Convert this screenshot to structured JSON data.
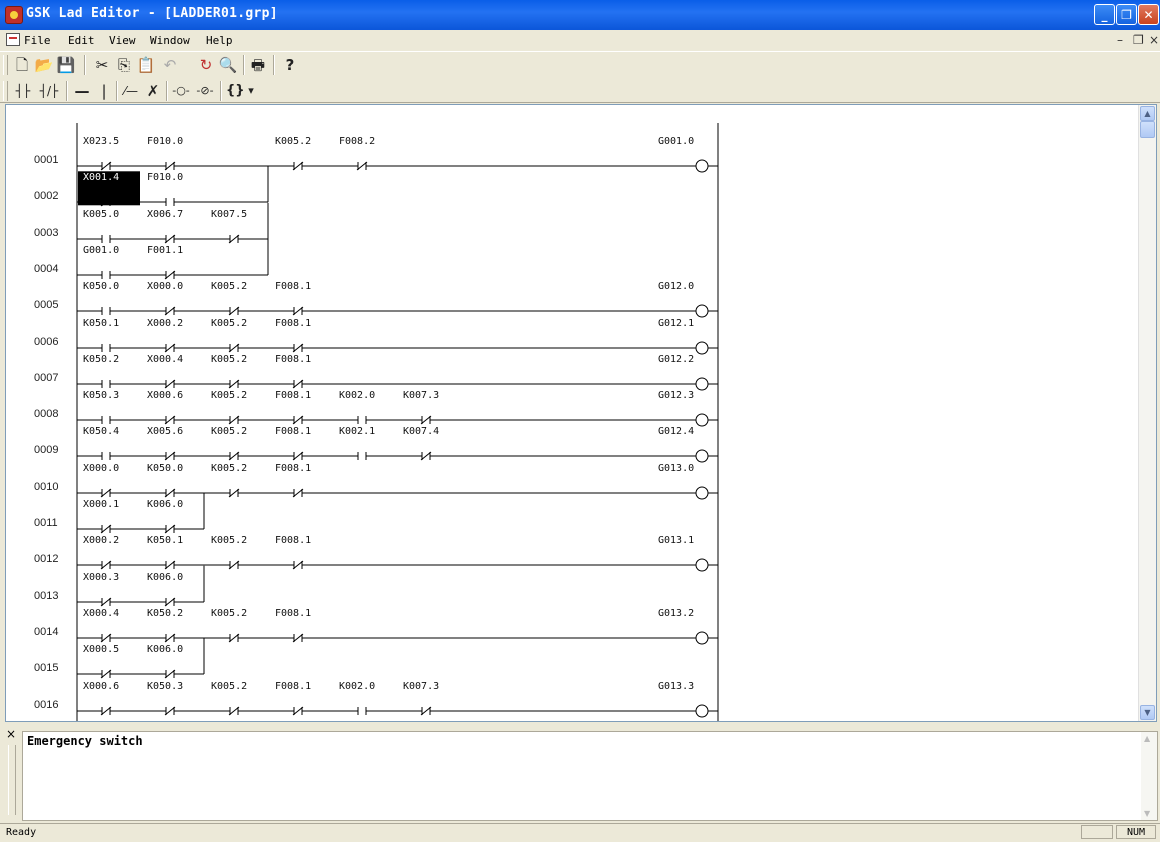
{
  "window": {
    "title": "GSK Lad Editor - [LADDER01.grp]"
  },
  "menu": [
    {
      "label": "File",
      "key": "F"
    },
    {
      "label": "Edit",
      "key": "E"
    },
    {
      "label": "View",
      "key": "V"
    },
    {
      "label": "Window",
      "key": "W"
    },
    {
      "label": "Help",
      "key": "H"
    }
  ],
  "toolbar1": [
    {
      "name": "new-icon",
      "glyph": "🗋"
    },
    {
      "name": "open-icon",
      "glyph": "📂"
    },
    {
      "name": "save-icon",
      "glyph": "💾"
    },
    {
      "name": "cut-icon",
      "glyph": "✂"
    },
    {
      "name": "copy-icon",
      "glyph": "⎘"
    },
    {
      "name": "paste-icon",
      "glyph": "📋"
    },
    {
      "name": "undo-icon",
      "glyph": "↶"
    },
    {
      "name": "refresh-icon",
      "glyph": "↻"
    },
    {
      "name": "find-icon",
      "glyph": "🔍"
    },
    {
      "name": "print-icon",
      "glyph": "🖶"
    },
    {
      "name": "help-icon",
      "glyph": "?"
    }
  ],
  "toolbar2": [
    {
      "name": "no-contact-icon",
      "glyph": "┤├"
    },
    {
      "name": "nc-contact-icon",
      "glyph": "┤/├"
    },
    {
      "name": "horizontal-line-icon",
      "glyph": "—"
    },
    {
      "name": "vertical-line-icon",
      "glyph": "|"
    },
    {
      "name": "draw-line-icon",
      "glyph": "⁄—"
    },
    {
      "name": "delete-line-icon",
      "glyph": "✗"
    },
    {
      "name": "coil-icon",
      "glyph": "-○-"
    },
    {
      "name": "nc-coil-icon",
      "glyph": "-⊘-"
    },
    {
      "name": "function-icon",
      "glyph": "{}"
    },
    {
      "name": "dropdown-icon",
      "glyph": "▾"
    }
  ],
  "rungs": [
    {
      "num": "0001",
      "contacts": [
        {
          "n": "X023.5",
          "t": "nc"
        },
        {
          "n": "F010.0",
          "t": "nc"
        },
        {
          "n": "",
          "t": "gap"
        },
        {
          "n": "K005.2",
          "t": "nc"
        },
        {
          "n": "F008.2",
          "t": "nc"
        }
      ],
      "coil": "G001.0"
    },
    {
      "num": "0002",
      "contacts": [
        {
          "n": "X001.4",
          "t": "nc",
          "hl": true
        },
        {
          "n": "F010.0",
          "t": "no"
        }
      ],
      "coil": ""
    },
    {
      "num": "0003",
      "contacts": [
        {
          "n": "K005.0",
          "t": "no"
        },
        {
          "n": "X006.7",
          "t": "nc"
        },
        {
          "n": "K007.5",
          "t": "nc"
        }
      ],
      "coil": ""
    },
    {
      "num": "0004",
      "contacts": [
        {
          "n": "G001.0",
          "t": "no"
        },
        {
          "n": "F001.1",
          "t": "nc"
        }
      ],
      "coil": ""
    },
    {
      "num": "0005",
      "contacts": [
        {
          "n": "K050.0",
          "t": "no"
        },
        {
          "n": "X000.0",
          "t": "nc"
        },
        {
          "n": "K005.2",
          "t": "nc"
        },
        {
          "n": "F008.1",
          "t": "nc"
        }
      ],
      "coil": "G012.0"
    },
    {
      "num": "0006",
      "contacts": [
        {
          "n": "K050.1",
          "t": "no"
        },
        {
          "n": "X000.2",
          "t": "nc"
        },
        {
          "n": "K005.2",
          "t": "nc"
        },
        {
          "n": "F008.1",
          "t": "nc"
        }
      ],
      "coil": "G012.1"
    },
    {
      "num": "0007",
      "contacts": [
        {
          "n": "K050.2",
          "t": "no"
        },
        {
          "n": "X000.4",
          "t": "nc"
        },
        {
          "n": "K005.2",
          "t": "nc"
        },
        {
          "n": "F008.1",
          "t": "nc"
        }
      ],
      "coil": "G012.2"
    },
    {
      "num": "0008",
      "contacts": [
        {
          "n": "K050.3",
          "t": "no"
        },
        {
          "n": "X000.6",
          "t": "nc"
        },
        {
          "n": "K005.2",
          "t": "nc"
        },
        {
          "n": "F008.1",
          "t": "nc"
        },
        {
          "n": "K002.0",
          "t": "no"
        },
        {
          "n": "K007.3",
          "t": "nc"
        }
      ],
      "coil": "G012.3"
    },
    {
      "num": "0009",
      "contacts": [
        {
          "n": "K050.4",
          "t": "no"
        },
        {
          "n": "X005.6",
          "t": "nc"
        },
        {
          "n": "K005.2",
          "t": "nc"
        },
        {
          "n": "F008.1",
          "t": "nc"
        },
        {
          "n": "K002.1",
          "t": "no"
        },
        {
          "n": "K007.4",
          "t": "nc"
        }
      ],
      "coil": "G012.4"
    },
    {
      "num": "0010",
      "contacts": [
        {
          "n": "X000.0",
          "t": "nc"
        },
        {
          "n": "K050.0",
          "t": "nc"
        },
        {
          "n": "K005.2",
          "t": "nc"
        },
        {
          "n": "F008.1",
          "t": "nc"
        }
      ],
      "coil": "G013.0"
    },
    {
      "num": "0011",
      "contacts": [
        {
          "n": "X000.1",
          "t": "nc"
        },
        {
          "n": "K006.0",
          "t": "nc"
        }
      ],
      "coil": ""
    },
    {
      "num": "0012",
      "contacts": [
        {
          "n": "X000.2",
          "t": "nc"
        },
        {
          "n": "K050.1",
          "t": "nc"
        },
        {
          "n": "K005.2",
          "t": "nc"
        },
        {
          "n": "F008.1",
          "t": "nc"
        }
      ],
      "coil": "G013.1"
    },
    {
      "num": "0013",
      "contacts": [
        {
          "n": "X000.3",
          "t": "nc"
        },
        {
          "n": "K006.0",
          "t": "nc"
        }
      ],
      "coil": ""
    },
    {
      "num": "0014",
      "contacts": [
        {
          "n": "X000.4",
          "t": "nc"
        },
        {
          "n": "K050.2",
          "t": "nc"
        },
        {
          "n": "K005.2",
          "t": "nc"
        },
        {
          "n": "F008.1",
          "t": "nc"
        }
      ],
      "coil": "G013.2"
    },
    {
      "num": "0015",
      "contacts": [
        {
          "n": "X000.5",
          "t": "nc"
        },
        {
          "n": "K006.0",
          "t": "nc"
        }
      ],
      "coil": ""
    },
    {
      "num": "0016",
      "contacts": [
        {
          "n": "X000.6",
          "t": "nc"
        },
        {
          "n": "K050.3",
          "t": "nc"
        },
        {
          "n": "K005.2",
          "t": "nc"
        },
        {
          "n": "F008.1",
          "t": "nc"
        },
        {
          "n": "K002.0",
          "t": "no"
        },
        {
          "n": "K007.3",
          "t": "nc"
        }
      ],
      "coil": "G013.3"
    }
  ],
  "output": {
    "text": "Emergency switch",
    "close_glyph": "×"
  },
  "status": {
    "left": "Ready",
    "num": "NUM"
  }
}
